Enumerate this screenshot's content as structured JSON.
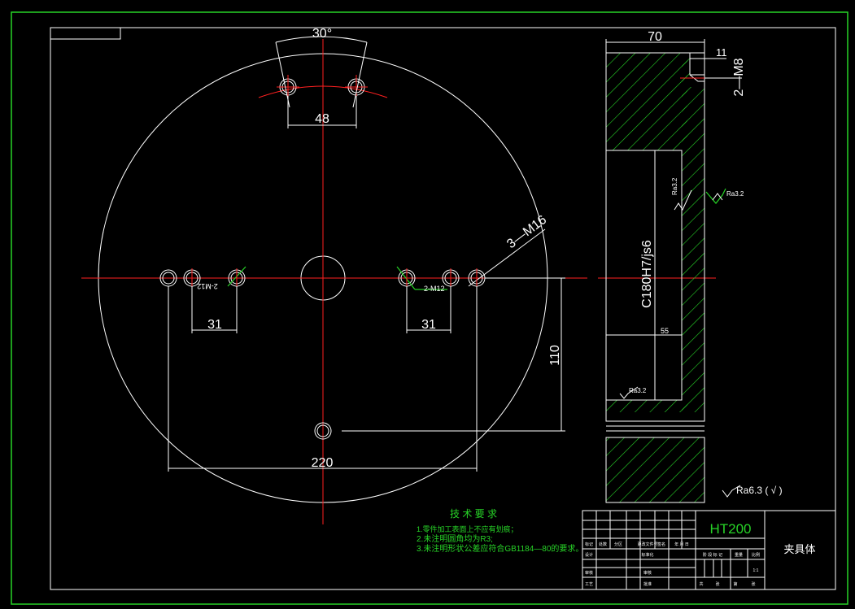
{
  "front_view": {
    "angle_label": "30°",
    "top_spacing_label": "48",
    "left_spacing_label": "31",
    "right_spacing_label": "31",
    "bottom_span_label": "220",
    "vertical_offset_label": "110",
    "thread_label_large": "3—M16",
    "thread_label_left": "2-M12",
    "thread_label_right": "2-M12"
  },
  "section_view": {
    "width_label": "70",
    "small_dim_label": "11",
    "thread_label": "2—M8",
    "bore_label": "C180H7/js6",
    "depth_label": "55",
    "roughness_inner": "Ra3.2",
    "roughness_outer": "Ra3.2",
    "roughness_bottom": "Ra3.2",
    "general_roughness": "Ra6.3 ( √ )"
  },
  "tech_requirements": {
    "title": "技 术 要 求",
    "items": [
      "1.零件加工表面上不应有划痕；",
      "2.未注明圆角均为R3;",
      "3.未注明形状公差应符合GB1184—80的要求。"
    ]
  },
  "title_block": {
    "material": "HT200",
    "part_name": "夹具体",
    "revision_headers": [
      "标记",
      "处数",
      "分区",
      "更改文件号",
      "签名",
      "年 月 日"
    ],
    "row_labels": [
      "设计",
      "审核",
      "工艺"
    ],
    "middle_labels": [
      "标准化",
      "审核",
      "批准"
    ],
    "stage_headers": [
      "阶 段 标 记",
      "重量",
      "比例"
    ],
    "stage_values": [
      "",
      "",
      "1:1"
    ],
    "sheet_labels": [
      "共",
      "张",
      "第",
      "张"
    ]
  },
  "colors": {
    "background": "#000000",
    "frame": "#ffffff",
    "centerline": "#ff2020",
    "hatch": "#27d327",
    "text_green": "#27d327"
  }
}
